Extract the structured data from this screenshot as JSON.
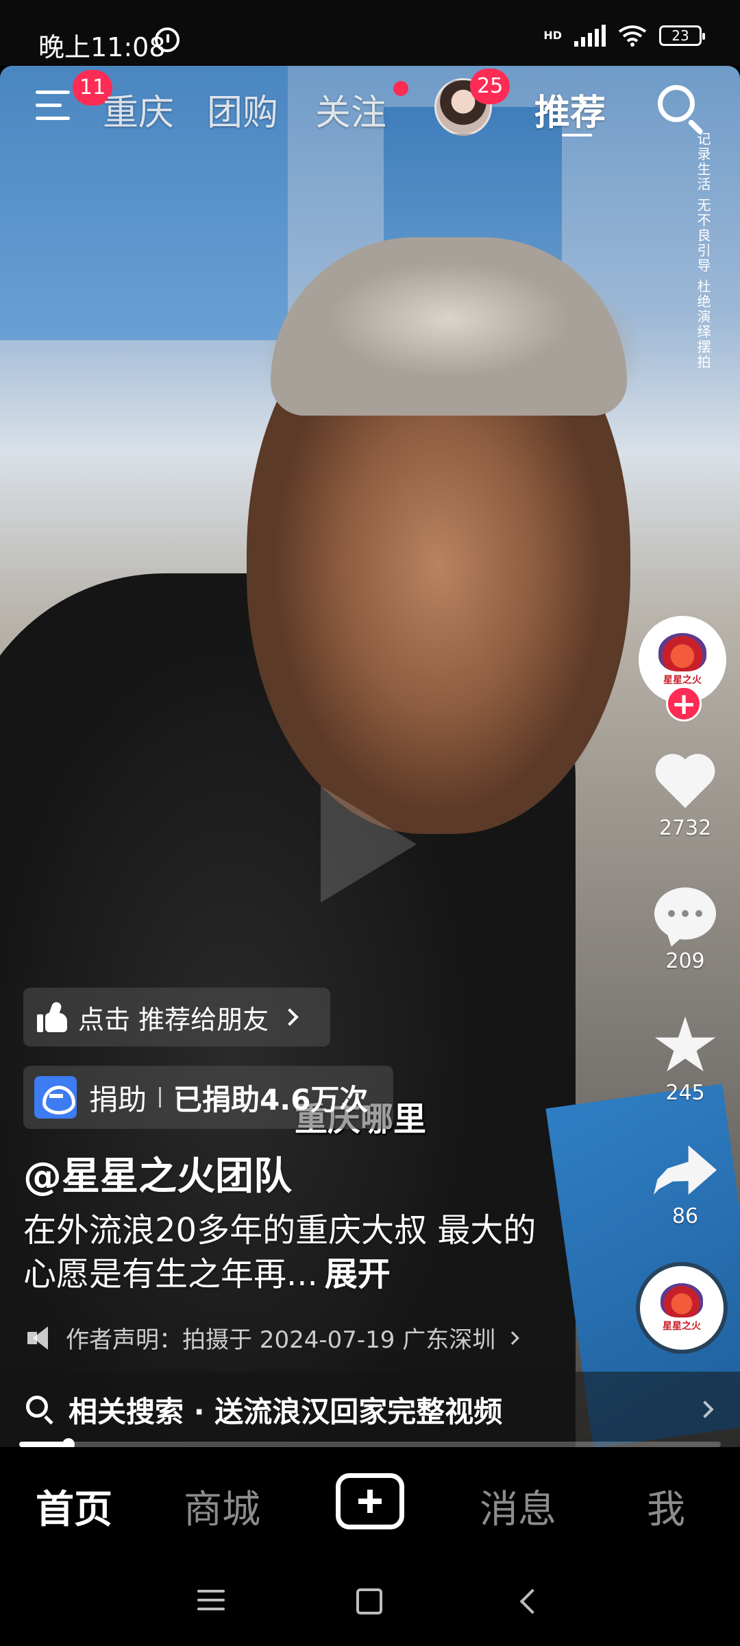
{
  "status_bar": {
    "time": "晚上11:08",
    "network_label": "HD",
    "battery": "23"
  },
  "top_nav": {
    "menu_badge": "11",
    "tabs": [
      {
        "label": "重庆"
      },
      {
        "label": "团购"
      },
      {
        "label": "关注"
      },
      {
        "label": "推荐"
      }
    ],
    "avatar_badge": "25",
    "active_tab": "推荐"
  },
  "video": {
    "watermark": "记录生活 无不良引导 杜绝演绎摆拍",
    "subtitle": "重庆哪里"
  },
  "actions": {
    "likes": "2732",
    "comments": "209",
    "favorites": "245",
    "shares": "86",
    "logo_text": "星星之火"
  },
  "info": {
    "recommend_text": "点击 推荐给朋友",
    "donate_label": "捐助",
    "donate_count": "已捐助4.6万次",
    "author": "@星星之火团队",
    "description": "在外流浪20多年的重庆大叔 最大的心愿是有生之年再...",
    "expand": "展开",
    "statement": "作者声明：拍摄于 2024-07-19 广东深圳"
  },
  "related_search": "相关搜索 · 送流浪汉回家完整视频",
  "playback": {
    "progress_fraction": 0.07
  },
  "bottom_tabs": {
    "home": "首页",
    "mall": "商城",
    "messages": "消息",
    "me": "我"
  },
  "colors": {
    "accent": "#fe2c55",
    "donate": "#3d7cf2"
  }
}
